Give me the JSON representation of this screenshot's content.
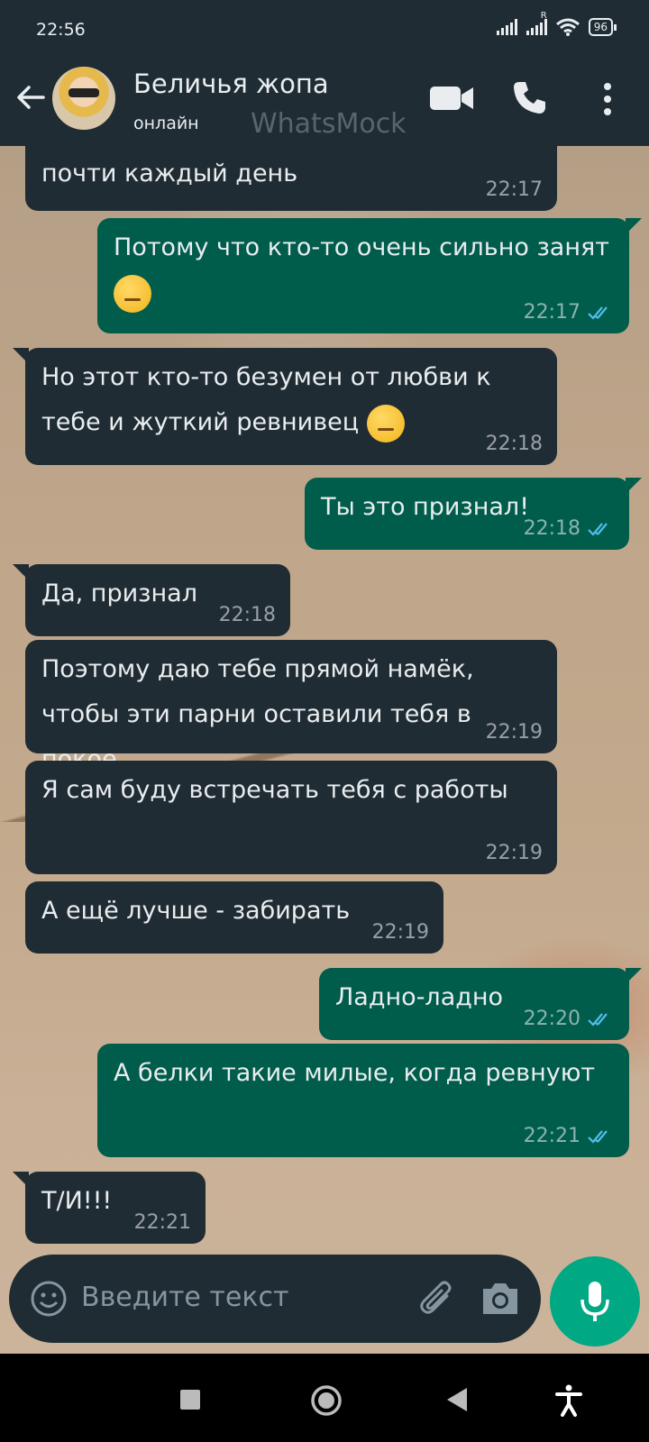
{
  "status_bar": {
    "time": "22:56",
    "signal_r": "R",
    "battery": "96"
  },
  "header": {
    "contact_name": "Беличья жопа",
    "status": "онлайн",
    "watermark": "WhatsMock"
  },
  "messages": [
    {
      "dir": "in",
      "text": "почти каждый день",
      "time": "22:17"
    },
    {
      "dir": "out",
      "text": "Потому что кто-то очень сильно занят",
      "emoji": "unamused-face-emoji",
      "time": "22:17",
      "read": true
    },
    {
      "dir": "in",
      "text": "Но этот кто-то безумен от любви к тебе и жуткий ревнивец",
      "emoji": "smirking-face-emoji",
      "time": "22:18"
    },
    {
      "dir": "out",
      "text": "Ты это признал!",
      "time": "22:18",
      "read": true
    },
    {
      "dir": "in",
      "text": "Да, признал",
      "time": "22:18"
    },
    {
      "dir": "in",
      "text": "Поэтому даю тебе прямой намёк, чтобы эти парни оставили тебя в покое",
      "time": "22:19"
    },
    {
      "dir": "in",
      "text": "Я сам буду встречать тебя с работы",
      "time": "22:19"
    },
    {
      "dir": "in",
      "text": "А ещё лучше - забирать",
      "time": "22:19"
    },
    {
      "dir": "out",
      "text": "Ладно-ладно",
      "time": "22:20",
      "read": true
    },
    {
      "dir": "out",
      "text": "А белки такие милые, когда ревнуют",
      "time": "22:21",
      "read": true
    },
    {
      "dir": "in",
      "text": "Т/И!!!",
      "time": "22:21"
    }
  ],
  "composer": {
    "placeholder": "Введите текст"
  },
  "colors": {
    "header_bg": "#1f2c34",
    "incoming_bubble": "#202c33",
    "outgoing_bubble": "#005c4b",
    "read_ticks": "#53bdeb",
    "mic_button": "#00a884"
  }
}
